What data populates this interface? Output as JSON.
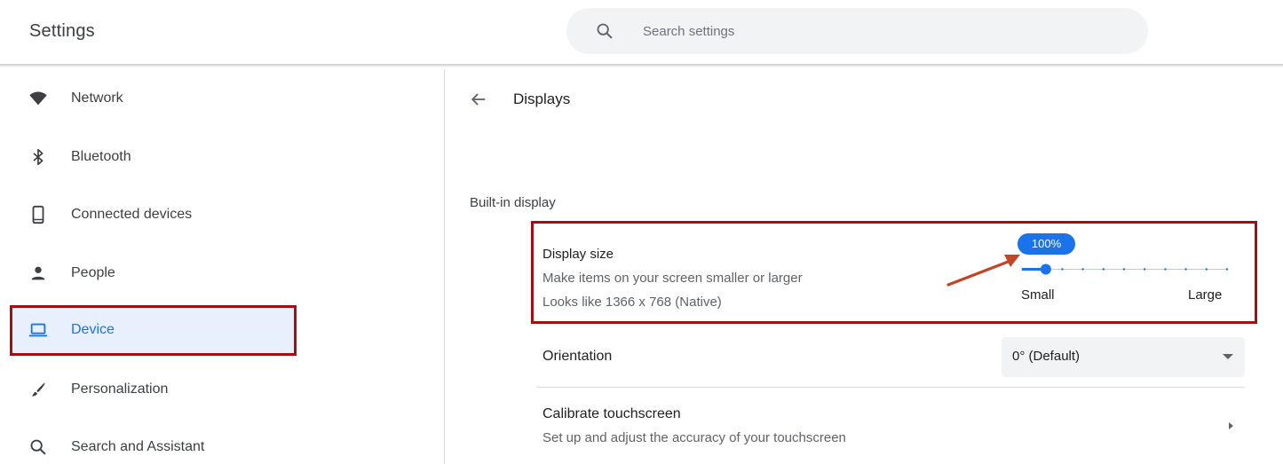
{
  "header": {
    "title": "Settings",
    "search_placeholder": "Search settings"
  },
  "sidebar": {
    "items": [
      {
        "label": "Network",
        "icon": "wifi-icon"
      },
      {
        "label": "Bluetooth",
        "icon": "bluetooth-icon"
      },
      {
        "label": "Connected devices",
        "icon": "phone-icon"
      },
      {
        "label": "People",
        "icon": "person-icon"
      },
      {
        "label": "Device",
        "icon": "laptop-icon",
        "active": true
      },
      {
        "label": "Personalization",
        "icon": "brush-icon"
      },
      {
        "label": "Search and Assistant",
        "icon": "search-icon"
      }
    ]
  },
  "main": {
    "page_title": "Displays",
    "section_label": "Built-in display",
    "display_size": {
      "title": "Display size",
      "description": "Make items on your screen smaller or larger",
      "native": "Looks like 1366 x 768 (Native)",
      "value_label": "100%",
      "slider_level": 0.12,
      "min_label": "Small",
      "max_label": "Large"
    },
    "orientation": {
      "label": "Orientation",
      "value": "0° (Default)"
    },
    "calibrate": {
      "title": "Calibrate touchscreen",
      "description": "Set up and adjust the accuracy of your touchscreen"
    }
  },
  "colors": {
    "accent": "#1a73e8",
    "highlight_border": "#a30d14",
    "annotation_arrow": "#c0462a",
    "active_bg": "#e8f0fe"
  }
}
